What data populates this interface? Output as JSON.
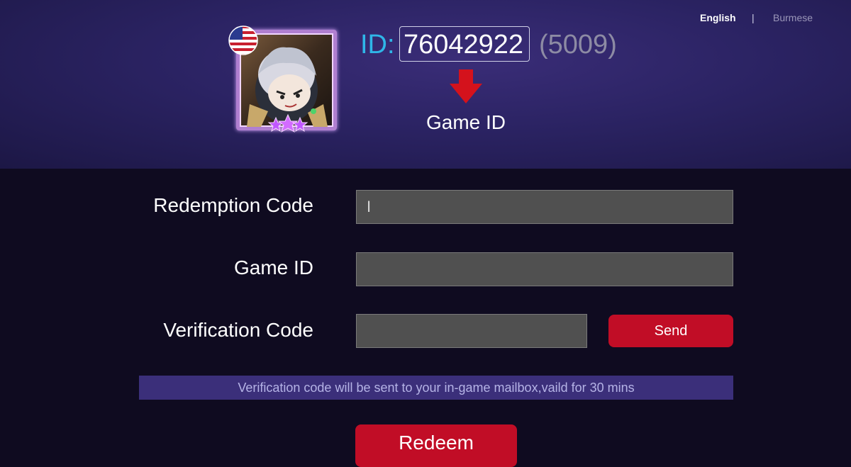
{
  "language": {
    "english": "English",
    "separator": "|",
    "burmese": "Burmese"
  },
  "profile": {
    "flag_icon": "us-flag-icon",
    "avatar_icon": "hero-avatar-icon",
    "id_label": "ID:",
    "id_value": "76042922",
    "server": "(5009)",
    "pointer_icon": "red-arrow-down-icon",
    "pointer_caption": "Game ID"
  },
  "form": {
    "redemption_label": "Redemption Code",
    "redemption_value": "I",
    "game_id_label": "Game ID",
    "game_id_value": "",
    "verification_label": "Verification Code",
    "verification_value": "",
    "send_label": "Send",
    "notice": "Verification code will be sent to your in-game mailbox,vaild for 30 mins",
    "redeem_label": "Redeem"
  },
  "colors": {
    "accent_red": "#c10d26",
    "id_blue": "#2fb6e8",
    "header_purple": "#2b2363",
    "notice_bg": "#3b2f7a"
  }
}
